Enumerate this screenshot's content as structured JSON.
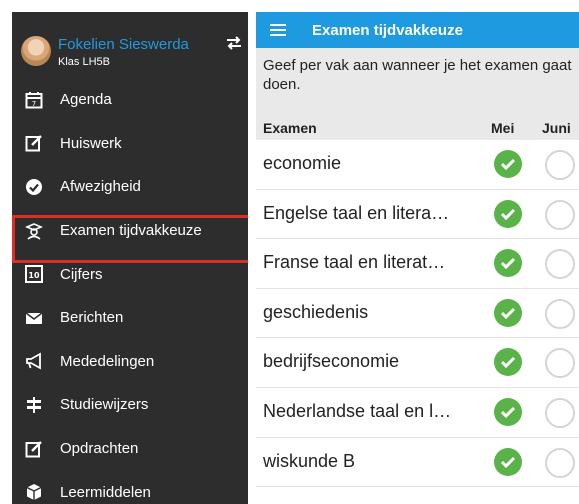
{
  "sidebar": {
    "user_name": "Fokelien Sieswerda",
    "user_class": "Klas LH5B",
    "items": [
      {
        "label": "Agenda",
        "icon": "calendar-icon"
      },
      {
        "label": "Huiswerk",
        "icon": "edit-icon"
      },
      {
        "label": "Afwezigheid",
        "icon": "check-circle-icon"
      },
      {
        "label": "Examen tijdvakkeuze",
        "icon": "graduate-icon"
      },
      {
        "label": "Cijfers",
        "icon": "grade-icon"
      },
      {
        "label": "Berichten",
        "icon": "mail-icon"
      },
      {
        "label": "Mededelingen",
        "icon": "megaphone-icon"
      },
      {
        "label": "Studiewijzers",
        "icon": "signpost-icon"
      },
      {
        "label": "Opdrachten",
        "icon": "edit-icon"
      },
      {
        "label": "Leermiddelen",
        "icon": "box-icon"
      }
    ],
    "highlighted_item": "Examen tijdvakkeuze",
    "highlight_color": "#d93025"
  },
  "appbar": {
    "title": "Examen tijdvakkeuze",
    "color": "#1e9be0"
  },
  "intro": {
    "text": "Geef per vak aan wanneer je het examen gaat doen."
  },
  "table": {
    "headers": {
      "subject": "Examen",
      "col1": "Mei",
      "col2": "Juni"
    },
    "rows": [
      {
        "subject": "economie",
        "mei": true,
        "juni": false
      },
      {
        "subject": "Engelse taal en litera…",
        "mei": true,
        "juni": false
      },
      {
        "subject": "Franse taal en literat…",
        "mei": true,
        "juni": false
      },
      {
        "subject": "geschiedenis",
        "mei": true,
        "juni": false
      },
      {
        "subject": "bedrijfseconomie",
        "mei": true,
        "juni": false
      },
      {
        "subject": "Nederlandse taal en l…",
        "mei": true,
        "juni": false
      },
      {
        "subject": "wiskunde B",
        "mei": true,
        "juni": false
      }
    ]
  }
}
